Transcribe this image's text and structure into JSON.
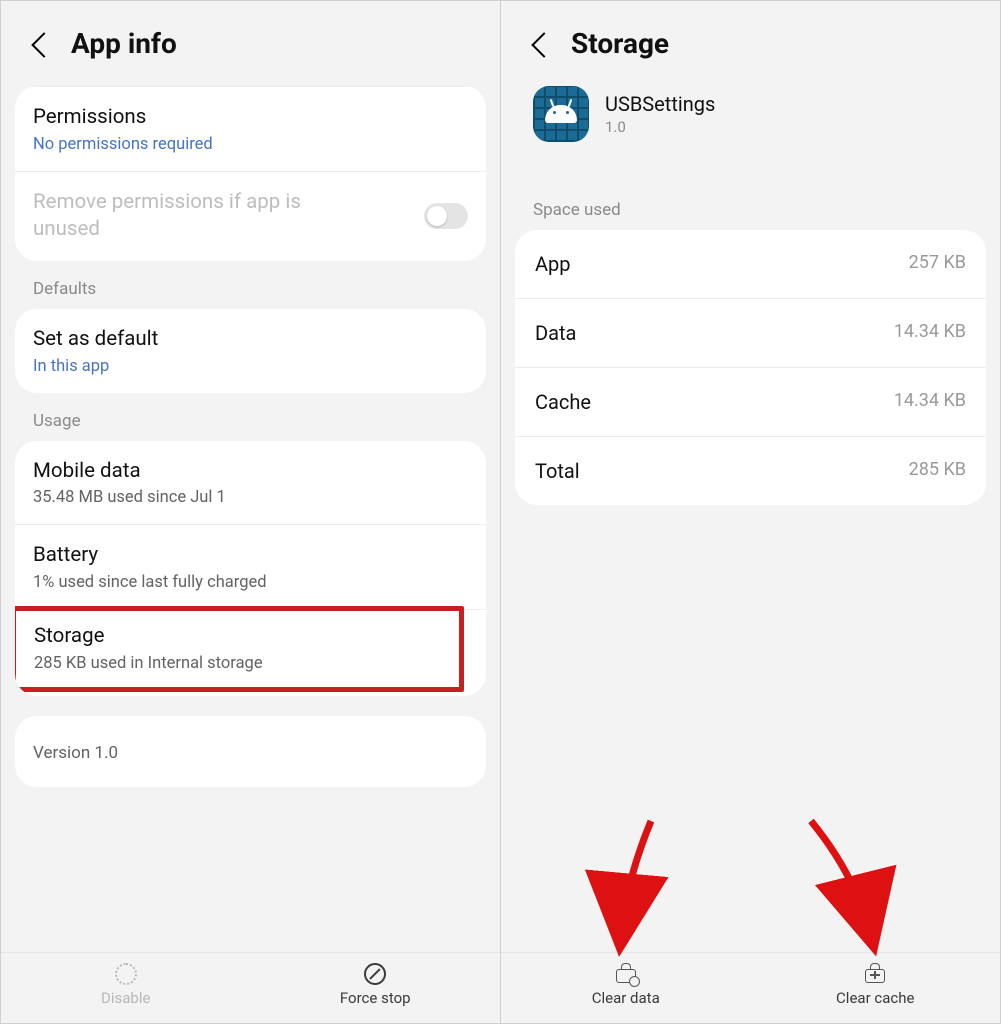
{
  "left": {
    "title": "App info",
    "permissions": {
      "title": "Permissions",
      "sub": "No permissions required"
    },
    "remove_perms": "Remove permissions if app is unused",
    "sections": {
      "defaults": "Defaults",
      "usage": "Usage"
    },
    "set_default": {
      "title": "Set as default",
      "sub": "In this app"
    },
    "mobile_data": {
      "title": "Mobile data",
      "sub": "35.48 MB used since Jul 1"
    },
    "battery": {
      "title": "Battery",
      "sub": "1% used since last fully charged"
    },
    "storage": {
      "title": "Storage",
      "sub": "285 KB used in Internal storage"
    },
    "version": "Version 1.0",
    "buttons": {
      "disable": "Disable",
      "force_stop": "Force stop"
    }
  },
  "right": {
    "title": "Storage",
    "app": {
      "name": "USBSettings",
      "version": "1.0"
    },
    "space_used_label": "Space used",
    "rows": {
      "app": {
        "key": "App",
        "val": "257 KB"
      },
      "data": {
        "key": "Data",
        "val": "14.34 KB"
      },
      "cache": {
        "key": "Cache",
        "val": "14.34 KB"
      },
      "total": {
        "key": "Total",
        "val": "285 KB"
      }
    },
    "buttons": {
      "clear_data": "Clear data",
      "clear_cache": "Clear cache"
    }
  }
}
